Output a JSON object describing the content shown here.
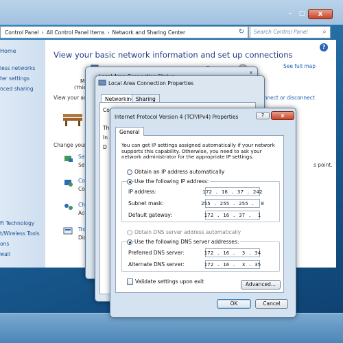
{
  "control_panel": {
    "address": {
      "crumb1": "Control Panel",
      "sep1": "›",
      "crumb2": "All Control Panel Items",
      "sep2": "›",
      "crumb3": "Network and Sharing Center",
      "dropdown": "▾",
      "refresh": "↻"
    },
    "search_placeholder": "Search Control Panel",
    "window_buttons": {
      "minimize": "–",
      "maximize": "□",
      "close": "x"
    },
    "help": "?",
    "left_pane": {
      "home": "Home",
      "links": [
        "less networks",
        "ter settings",
        "nced sharing"
      ],
      "see_also": [
        "Fi Technology",
        "t/Wireless Tools",
        "ons",
        "wall"
      ]
    },
    "heading": "View your basic network information and set up connections",
    "see_full_map": "See full map",
    "view_active": "View your acti",
    "connect_disconnect": "onnect or disconnect",
    "change_network": "Change your n",
    "fragments": {
      "mo": "MO",
      "this": "(This c",
      "point": "s point."
    },
    "tasks": [
      {
        "link": "Set",
        "desc": "Set"
      },
      {
        "link": "Con",
        "desc": "Cor"
      },
      {
        "link": "Cho",
        "desc": "Acc"
      },
      {
        "link": "Trou",
        "desc": "Diag"
      }
    ]
  },
  "dialogs": {
    "status": {
      "title": "Local Area Connection Status",
      "close": "x"
    },
    "properties": {
      "title": "Local Area Connection Properties",
      "tabs": [
        "Networking",
        "Sharing"
      ],
      "fragments": [
        "Co",
        "Th",
        "In",
        "D"
      ]
    },
    "ipv4": {
      "title": "Internet Protocol Version 4 (TCP/IPv4) Properties",
      "help": "?",
      "close": "x",
      "tab": "General",
      "description": "You can get IP settings assigned automatically if your network supports this capability. Otherwise, you need to ask your network administrator for the appropriate IP settings.",
      "ip_mode": {
        "auto_label": "Obtain an IP address automatically",
        "manual_label": "Use the following IP address:",
        "selected": "manual"
      },
      "fields": {
        "ip_label": "IP address:",
        "ip_value": "172 . 16 . 37 . 242",
        "subnet_label": "Subnet mask:",
        "subnet_value": "255 . 255 . 255 .  0",
        "gateway_label": "Default gateway:",
        "gateway_value": "172 . 16 . 37 .  1"
      },
      "dns_mode": {
        "auto_label": "Obtain DNS server address automatically",
        "manual_label": "Use the following DNS server addresses:",
        "selected": "manual"
      },
      "dns": {
        "preferred_label": "Preferred DNS server:",
        "preferred_value": "172 . 16 .  3 . 34",
        "alternate_label": "Alternate DNS server:",
        "alternate_value": "172 . 16 .  3 . 35"
      },
      "validate_label": "Validate settings upon exit",
      "validate_checked": false,
      "advanced_button": "Advanced...",
      "ok_button": "OK",
      "cancel_button": "Cancel"
    }
  },
  "colors": {
    "link_blue": "#1b5fb3",
    "heading_blue": "#1e3a87",
    "dialog_bg": "#dbe6f1",
    "close_red": "#c8432a"
  }
}
